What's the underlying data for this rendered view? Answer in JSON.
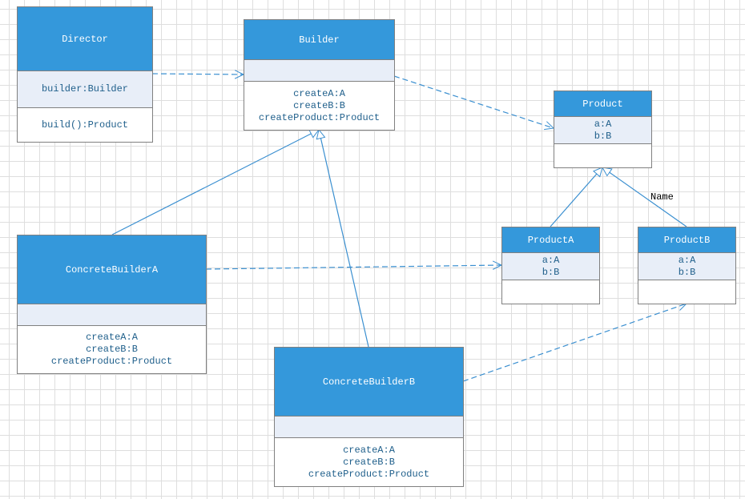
{
  "colors": {
    "header": "#3498db",
    "attributes": "#e8eef8",
    "line": "#3a8fd0",
    "text": "#1f5f8b"
  },
  "classes": {
    "director": {
      "name": "Director",
      "attributes": [
        "builder:Builder"
      ],
      "operations": [
        "build():Product"
      ]
    },
    "builder": {
      "name": "Builder",
      "attributes": [],
      "operations": [
        "createA:A",
        "createB:B",
        "createProduct:Product"
      ]
    },
    "product": {
      "name": "Product",
      "attributes": [
        "a:A",
        "b:B"
      ],
      "operations": []
    },
    "product_a": {
      "name": "ProductA",
      "attributes": [
        "a:A",
        "b:B"
      ],
      "operations": []
    },
    "product_b": {
      "name": "ProductB",
      "attributes": [
        "a:A",
        "b:B"
      ],
      "operations": []
    },
    "concrete_builder_a": {
      "name": "ConcreteBuilderA",
      "attributes": [],
      "operations": [
        "createA:A",
        "createB:B",
        "createProduct:Product"
      ]
    },
    "concrete_builder_b": {
      "name": "ConcreteBuilderB",
      "attributes": [],
      "operations": [
        "createA:A",
        "createB:B",
        "createProduct:Product"
      ]
    }
  },
  "relations": [
    {
      "from": "director",
      "to": "builder",
      "type": "dependency"
    },
    {
      "from": "builder",
      "to": "product",
      "type": "dependency"
    },
    {
      "from": "concrete_builder_a",
      "to": "product_a",
      "type": "dependency"
    },
    {
      "from": "concrete_builder_b",
      "to": "product_b",
      "type": "dependency"
    },
    {
      "from": "concrete_builder_a",
      "to": "builder",
      "type": "generalization"
    },
    {
      "from": "concrete_builder_b",
      "to": "builder",
      "type": "generalization"
    },
    {
      "from": "product_a",
      "to": "product",
      "type": "generalization"
    },
    {
      "from": "product_b",
      "to": "product",
      "type": "generalization",
      "label": "Name"
    }
  ]
}
